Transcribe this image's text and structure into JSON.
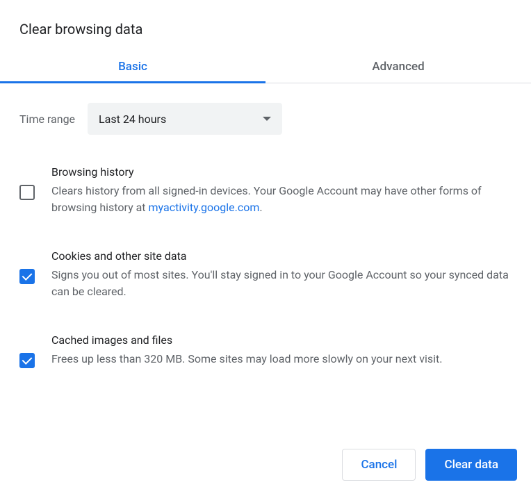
{
  "title": "Clear browsing data",
  "tabs": {
    "basic": "Basic",
    "advanced": "Advanced"
  },
  "time_range": {
    "label": "Time range",
    "selected": "Last 24 hours"
  },
  "options": {
    "browsing_history": {
      "title": "Browsing history",
      "desc_prefix": "Clears history from all signed-in devices. Your Google Account may have other forms of browsing history at ",
      "link": "myactivity.google.com",
      "desc_suffix": ".",
      "checked": false
    },
    "cookies": {
      "title": "Cookies and other site data",
      "desc": "Signs you out of most sites. You'll stay signed in to your Google Account so your synced data can be cleared.",
      "checked": true
    },
    "cache": {
      "title": "Cached images and files",
      "desc": "Frees up less than 320 MB. Some sites may load more slowly on your next visit.",
      "checked": true
    }
  },
  "buttons": {
    "cancel": "Cancel",
    "clear": "Clear data"
  }
}
